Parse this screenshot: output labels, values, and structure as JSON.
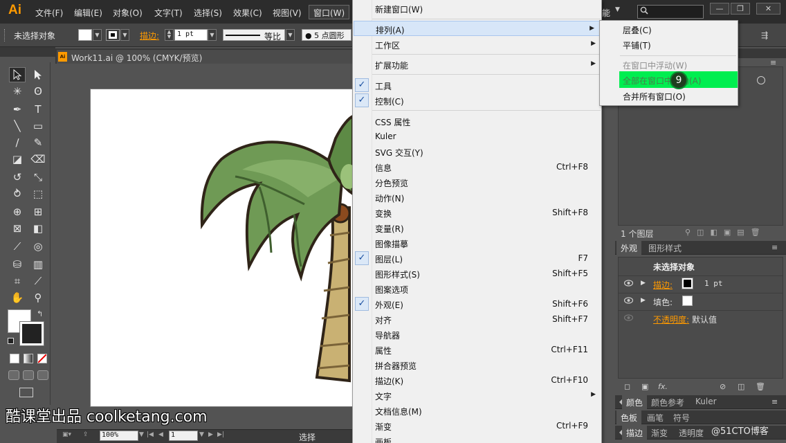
{
  "app": {
    "logo": "Ai",
    "menus": [
      "文件(F)",
      "编辑(E)",
      "对象(O)",
      "文字(T)",
      "选择(S)",
      "效果(C)",
      "视图(V)",
      "窗口(W)"
    ],
    "essentials_partial": "能",
    "window_controls": [
      "—",
      "❐",
      "✕"
    ]
  },
  "control_bar": {
    "selection_status": "未选择对象",
    "stroke_label": "描边:",
    "stroke_weight": "1 pt",
    "profile_label": "等比",
    "brush_label": "5 点圆形"
  },
  "document": {
    "tab_title": "Work11.ai @ 100% (CMYK/预览)",
    "ai_icon_text": "Ai"
  },
  "status_bar": {
    "zoom": "100%",
    "page": "1",
    "tool_status": "选择"
  },
  "watermark": {
    "left": "酷课堂出品 coolketang.com",
    "right": "@51CTO博客"
  },
  "window_menu": {
    "items": [
      {
        "label": "新建窗口(W)",
        "shortcut": "",
        "checked": false,
        "submenu": false
      },
      {
        "label": "排列(A)",
        "shortcut": "",
        "checked": false,
        "submenu": true,
        "highlighted": true
      },
      {
        "label": "工作区",
        "shortcut": "",
        "checked": false,
        "submenu": true
      },
      {
        "label": "扩展功能",
        "shortcut": "",
        "checked": false,
        "submenu": true
      },
      {
        "label": "工具",
        "shortcut": "",
        "checked": true,
        "submenu": false
      },
      {
        "label": "控制(C)",
        "shortcut": "",
        "checked": true,
        "submenu": false
      },
      {
        "label": "CSS 属性",
        "shortcut": "",
        "checked": false,
        "submenu": false
      },
      {
        "label": "Kuler",
        "shortcut": "",
        "checked": false,
        "submenu": false
      },
      {
        "label": "SVG 交互(Y)",
        "shortcut": "",
        "checked": false,
        "submenu": false
      },
      {
        "label": "信息",
        "shortcut": "Ctrl+F8",
        "checked": false,
        "submenu": false
      },
      {
        "label": "分色预览",
        "shortcut": "",
        "checked": false,
        "submenu": false
      },
      {
        "label": "动作(N)",
        "shortcut": "",
        "checked": false,
        "submenu": false
      },
      {
        "label": "变换",
        "shortcut": "Shift+F8",
        "checked": false,
        "submenu": false
      },
      {
        "label": "变量(R)",
        "shortcut": "",
        "checked": false,
        "submenu": false
      },
      {
        "label": "图像描摹",
        "shortcut": "",
        "checked": false,
        "submenu": false
      },
      {
        "label": "图层(L)",
        "shortcut": "F7",
        "checked": true,
        "submenu": false
      },
      {
        "label": "图形样式(S)",
        "shortcut": "Shift+F5",
        "checked": false,
        "submenu": false
      },
      {
        "label": "图案选项",
        "shortcut": "",
        "checked": false,
        "submenu": false
      },
      {
        "label": "外观(E)",
        "shortcut": "Shift+F6",
        "checked": true,
        "submenu": false
      },
      {
        "label": "对齐",
        "shortcut": "Shift+F7",
        "checked": false,
        "submenu": false
      },
      {
        "label": "导航器",
        "shortcut": "",
        "checked": false,
        "submenu": false
      },
      {
        "label": "属性",
        "shortcut": "Ctrl+F11",
        "checked": false,
        "submenu": false
      },
      {
        "label": "拼合器预览",
        "shortcut": "",
        "checked": false,
        "submenu": false
      },
      {
        "label": "描边(K)",
        "shortcut": "Ctrl+F10",
        "checked": false,
        "submenu": false
      },
      {
        "label": "文字",
        "shortcut": "",
        "checked": false,
        "submenu": true
      },
      {
        "label": "文档信息(M)",
        "shortcut": "",
        "checked": false,
        "submenu": false
      },
      {
        "label": "渐变",
        "shortcut": "Ctrl+F9",
        "checked": false,
        "submenu": false
      },
      {
        "label": "画板",
        "shortcut": "",
        "checked": false,
        "submenu": false
      }
    ]
  },
  "arrange_submenu": {
    "items": [
      {
        "label": "层叠(C)",
        "disabled": false
      },
      {
        "label": "平铺(T)",
        "disabled": false
      },
      {
        "label": "在窗口中浮动(W)",
        "disabled": true
      },
      {
        "label": "全部在窗口中浮动(A)",
        "disabled": false,
        "highlighted": true
      },
      {
        "label": "合并所有窗口(O)",
        "disabled": false
      }
    ],
    "step_badge": "9"
  },
  "layers_panel": {
    "count_label": "1 个图层"
  },
  "appearance_panel": {
    "tabs": [
      "外观",
      "图形样式"
    ],
    "title": "未选择对象",
    "stroke_label": "描边:",
    "stroke_value": "1 pt",
    "fill_label": "填色:",
    "opacity_label": "不透明度:",
    "opacity_value": "默认值"
  },
  "bottom_panels": {
    "row1_tabs": [
      "颜色",
      "颜色参考",
      "Kuler"
    ],
    "row2_tabs": [
      "色板",
      "画笔",
      "符号"
    ],
    "row3_tabs": [
      "描边",
      "渐变",
      "透明度"
    ]
  },
  "colors": {
    "accent_orange": "#ff9a00",
    "menu_bg": "#f0f0f0",
    "highlight_green": "#00ee50",
    "ui_dark": "#535353"
  }
}
